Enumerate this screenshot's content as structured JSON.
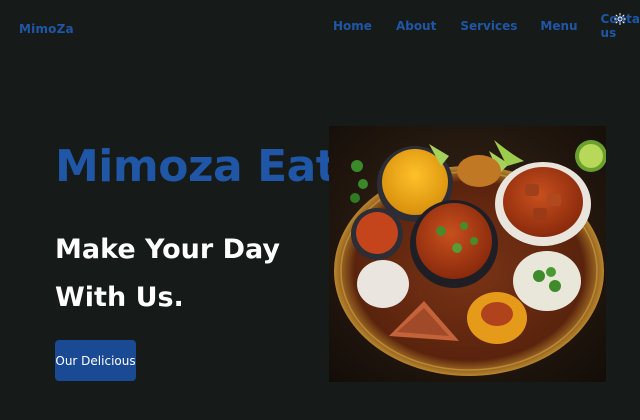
{
  "brand": {
    "logo_text": "MimoZa"
  },
  "nav": {
    "items": [
      {
        "label": "Home"
      },
      {
        "label": "About"
      },
      {
        "label": "Services"
      },
      {
        "label": "Menu"
      },
      {
        "label": "Contact us"
      }
    ],
    "theme_toggle_icon": "sun-icon"
  },
  "hero": {
    "title": "Mimoza Eats",
    "subtitle_line1": "Make Your Day",
    "subtitle_line2": "With Us.",
    "cta_label": "Our Delicious",
    "image_icon": "food-platter-image"
  },
  "colors": {
    "background": "#161a19",
    "brand_blue": "#1f56a6",
    "button_blue": "#1a4a94",
    "text_white": "#ffffff"
  }
}
